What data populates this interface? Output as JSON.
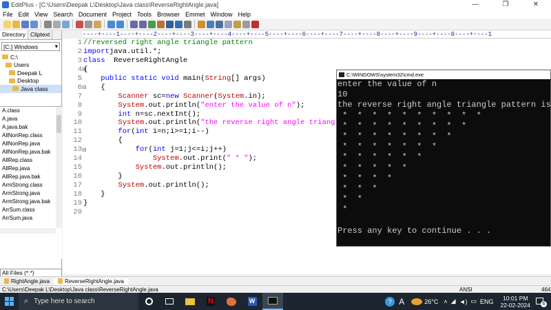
{
  "window": {
    "title": "EditPlus - [C:\\Users\\Deepak L\\Desktop\\Java class\\ReverseRightAngle.java]",
    "controls": [
      "—",
      "❐",
      "✕"
    ]
  },
  "menu": [
    "File",
    "Edit",
    "View",
    "Search",
    "Document",
    "Project",
    "Tools",
    "Browser",
    "Emmet",
    "Window",
    "Help"
  ],
  "sidebar": {
    "tabs": [
      "Directory",
      "Cliptext"
    ],
    "drive": "[C:] Windows",
    "tree": [
      "C:\\",
      "Users",
      "Deepak L",
      "Desktop",
      "Java class"
    ],
    "files": [
      "A.class",
      "A.java",
      "A.java.bak",
      "AllNonRep.class",
      "AllNonRep.java",
      "AllNonRep.java.bak",
      "AllRep.class",
      "AllRep.java",
      "AllRep.java.bak",
      "ArmStrong.class",
      "ArmStrong.java",
      "ArmStrong.java.bak",
      "ArrSum.class",
      "ArrSum.java"
    ],
    "filter": "All Files (*.*)"
  },
  "ruler": "----+----1----+----2----+----3----+----4----+----5----+----6----+----7----+----8----+----9----+----0----+----1",
  "editor": {
    "line_numbers": [
      "1",
      "2",
      "3",
      "4",
      "5",
      "6",
      "7",
      "8",
      "9",
      "10",
      "11",
      "12",
      "13",
      "14",
      "15",
      "16",
      "17",
      "18",
      "19",
      "20"
    ]
  },
  "console": {
    "title": "C:\\WINDOWS\\system32\\cmd.exe",
    "lines": [
      "enter the value of n",
      "10",
      "the reverse right angle triangle pattern is",
      " *  *  *  *  *  *  *  *  *  *",
      " *  *  *  *  *  *  *  *  *",
      " *  *  *  *  *  *  *  *",
      " *  *  *  *  *  *  *",
      " *  *  *  *  *  *",
      " *  *  *  *  *",
      " *  *  *  *",
      " *  *  *",
      " *  *",
      " *",
      "",
      "Press any key to continue . . ."
    ]
  },
  "doc_tabs": [
    "RightAngle.java",
    "ReverseRightAngle.java"
  ],
  "status": {
    "path": "C:\\Users\\Deepak L\\Desktop\\Java class\\ReverseRightAngle.java",
    "encoding": "ANSI",
    "size": "464"
  },
  "taskbar": {
    "search_placeholder": "Type here to search",
    "temperature": "26°C",
    "language": "ENG",
    "time": "10:01 PM",
    "date": "22-02-2024",
    "notification_count": "6"
  },
  "colors": {
    "keyword": "#0000ff",
    "comment": "#008000",
    "string": "#ff00ff",
    "class_name": "#c00000",
    "console_bg": "#0c0c0c",
    "taskbar_bg": "#1c2530"
  }
}
